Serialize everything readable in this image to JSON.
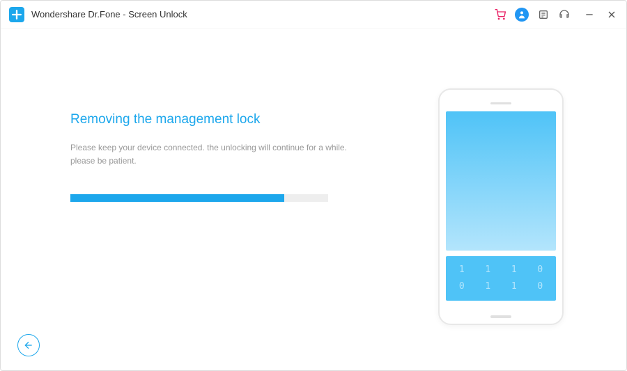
{
  "window": {
    "title": "Wondershare Dr.Fone - Screen Unlock"
  },
  "main": {
    "heading": "Removing the management lock",
    "subtext_line1": "Please keep your device connected. the unlocking will continue for a while.",
    "subtext_line2": "please be patient.",
    "progress_percent": 83
  },
  "colors": {
    "accent": "#1ca7ec"
  }
}
